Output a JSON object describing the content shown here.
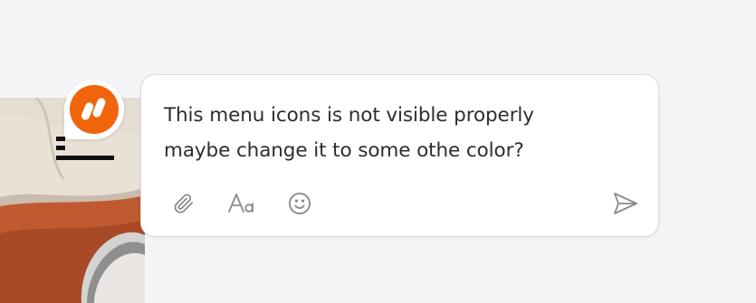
{
  "comment": {
    "text": "This menu icons is not visible properly\nmaybe change it to some othe color?"
  },
  "toolbar": {
    "attach_icon": "paperclip-icon",
    "format_icon": "text-format-icon",
    "emoji_icon": "smiley-icon",
    "send_icon": "send-icon"
  },
  "colors": {
    "avatar_brand": "#f0650c",
    "icon_gray": "#8a8a8e",
    "text": "#2d2d2d",
    "card_border": "#d9d9dd",
    "background": "#f5f5f7"
  }
}
